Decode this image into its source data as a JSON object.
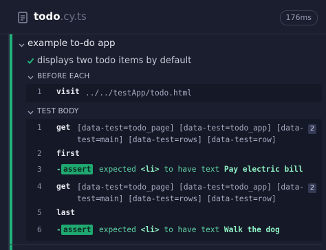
{
  "header": {
    "spec_base": "todo",
    "spec_ext": ".cy.ts",
    "duration": "176ms"
  },
  "suite": {
    "title": "example to-do app"
  },
  "test": {
    "title": "displays two todo items by default",
    "state": "passed"
  },
  "before_each": {
    "label": "BEFORE EACH",
    "commands": [
      {
        "num": "1",
        "name": "visit",
        "message": "../../testApp/todo.html"
      }
    ]
  },
  "test_body": {
    "label": "TEST BODY",
    "commands": [
      {
        "num": "1",
        "name": "get",
        "message": "[data-test=todo_page] [data-test=todo_app] [data-\ntest=main] [data-test=rows] [data-test=row]",
        "count": "2"
      },
      {
        "num": "2",
        "name": "first"
      },
      {
        "num": "3",
        "assert_label": "assert",
        "dash": "-",
        "expected": "expected",
        "element": "<li>",
        "middle": "to have text",
        "value": "Pay electric bill"
      },
      {
        "num": "4",
        "name": "get",
        "message": "[data-test=todo_page] [data-test=todo_app] [data-\ntest=main] [data-test=rows] [data-test=row]",
        "count": "2"
      },
      {
        "num": "5",
        "name": "last"
      },
      {
        "num": "6",
        "assert_label": "assert",
        "dash": "-",
        "expected": "expected",
        "element": "<li>",
        "middle": "to have text",
        "value": "Walk the dog"
      }
    ]
  },
  "colors": {
    "passed": "#1fb37a",
    "background": "#1b1e2e",
    "panel": "#151826",
    "assert_text": "#5fd3a6"
  },
  "icons": {
    "spec_file": "file-icon",
    "suite_toggle": "chevron-down-icon",
    "test_state": "check-icon"
  }
}
